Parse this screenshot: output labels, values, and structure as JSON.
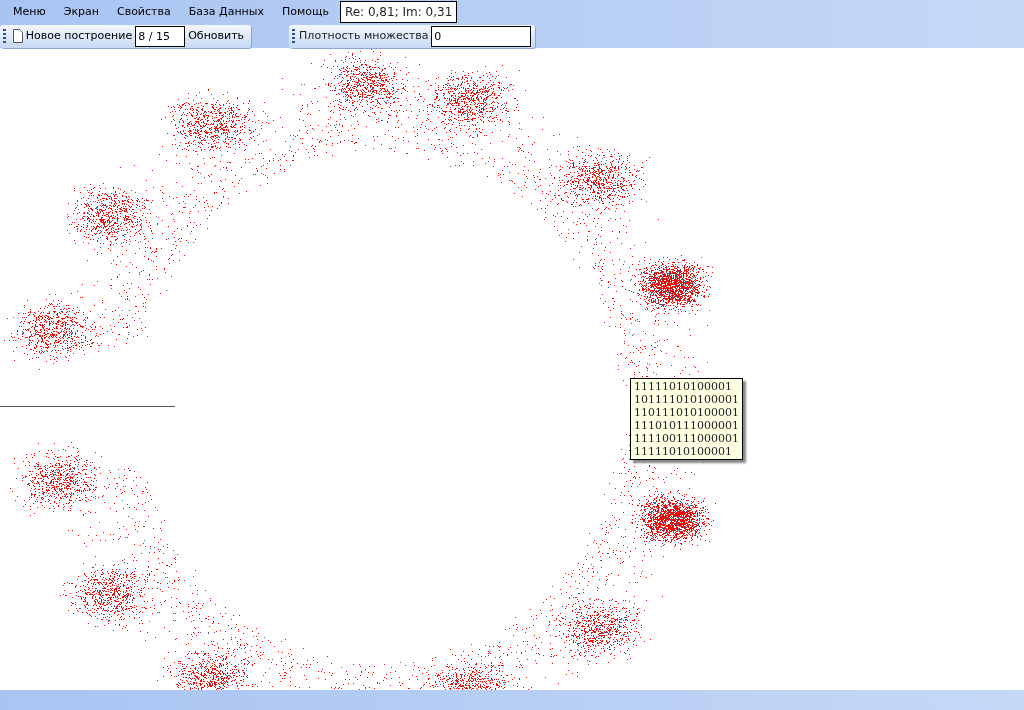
{
  "menu": [
    "Меню",
    "Экран",
    "Свойства",
    "База Данных",
    "Помощь"
  ],
  "coordinates": "Re: 0,81; Im: 0,31",
  "toolbar_build": {
    "button": "Новое построение",
    "value": "8 / 15",
    "refresh": "Обновить"
  },
  "toolbar_density": {
    "label": "Плотность множества",
    "value": "0"
  },
  "tooltip": [
    "11111010100001",
    "101111010100001",
    "110111010100001",
    "111010111000001",
    "111100111000001",
    "11111010100001"
  ]
}
